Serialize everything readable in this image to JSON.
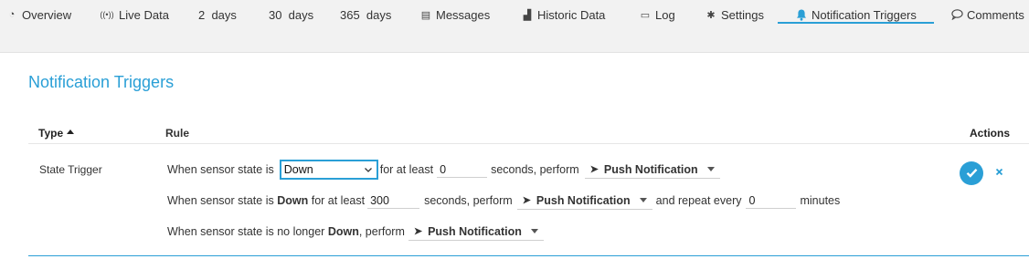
{
  "tabs": [
    {
      "label": "Overview",
      "icon": "overview-icon",
      "glyph": "◔"
    },
    {
      "label": "Live Data",
      "icon": "live-data-icon",
      "glyph": "((•))"
    },
    {
      "label": "2  days",
      "icon": "",
      "glyph": ""
    },
    {
      "label": "30  days",
      "icon": "",
      "glyph": ""
    },
    {
      "label": "365  days",
      "icon": "",
      "glyph": ""
    },
    {
      "label": "Messages",
      "icon": "messages-icon",
      "glyph": "▤"
    },
    {
      "label": "Historic Data",
      "icon": "historic-data-icon",
      "glyph": "▟"
    },
    {
      "label": "Log",
      "icon": "log-icon",
      "glyph": "▭"
    },
    {
      "label": "Settings",
      "icon": "gear-icon",
      "glyph": "✱"
    },
    {
      "label": "Notification Triggers",
      "icon": "bell-icon",
      "glyph": "🔔"
    },
    {
      "label": "Comments",
      "icon": "comment-icon",
      "glyph": "◯"
    }
  ],
  "active_tab": "Notification Triggers",
  "section_title": "Notification Triggers",
  "table": {
    "headers": {
      "type": "Type",
      "rule": "Rule",
      "actions": "Actions"
    },
    "row": {
      "type": "State Trigger",
      "line1": {
        "prefix": "When sensor state is",
        "state_value": "Down",
        "for_at_least": "for at least",
        "seconds_value": "0",
        "seconds_perform": "seconds, perform",
        "action": "Push Notification"
      },
      "line2": {
        "prefix": "When sensor state is",
        "state": "Down",
        "for_at_least": "for at least",
        "seconds_value": "300",
        "seconds_perform": "seconds, perform",
        "action": "Push Notification",
        "repeat": "and repeat every",
        "repeat_value": "0",
        "minutes": "minutes"
      },
      "line3": {
        "prefix": "When sensor state is no longer",
        "state": "Down",
        "perform": ", perform",
        "action": "Push Notification"
      }
    }
  },
  "colors": {
    "accent": "#2a9fd6"
  }
}
